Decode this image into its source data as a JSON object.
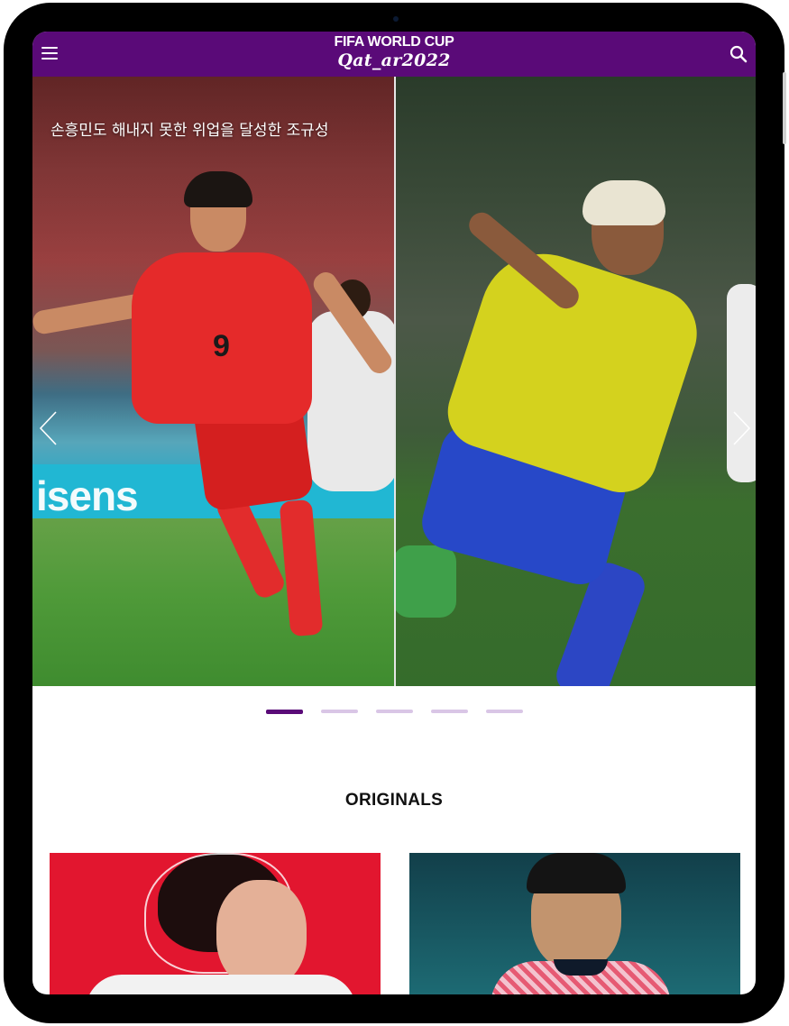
{
  "header": {
    "logo_top": "FIFA WORLD CUP",
    "logo_bottom": "Qat_ar2022",
    "menu_icon": "hamburger-menu-icon",
    "search_icon": "search-icon",
    "bar_color": "#5a0a78"
  },
  "hero": {
    "caption": "손흥민도 해내지 못한 위업을 달성한 조규성",
    "banner_word": "isens",
    "left_player_number": "9",
    "prev_icon": "chevron-left-icon",
    "next_icon": "chevron-right-icon"
  },
  "carousel": {
    "total_slides": 5,
    "active_index": 0,
    "active_color": "#5a0a78",
    "inactive_color": "#d9c6e6"
  },
  "originals": {
    "title": "ORIGINALS",
    "cards": [
      {
        "accent": "#e2162f"
      },
      {
        "accent": "#1d6b74"
      }
    ]
  }
}
